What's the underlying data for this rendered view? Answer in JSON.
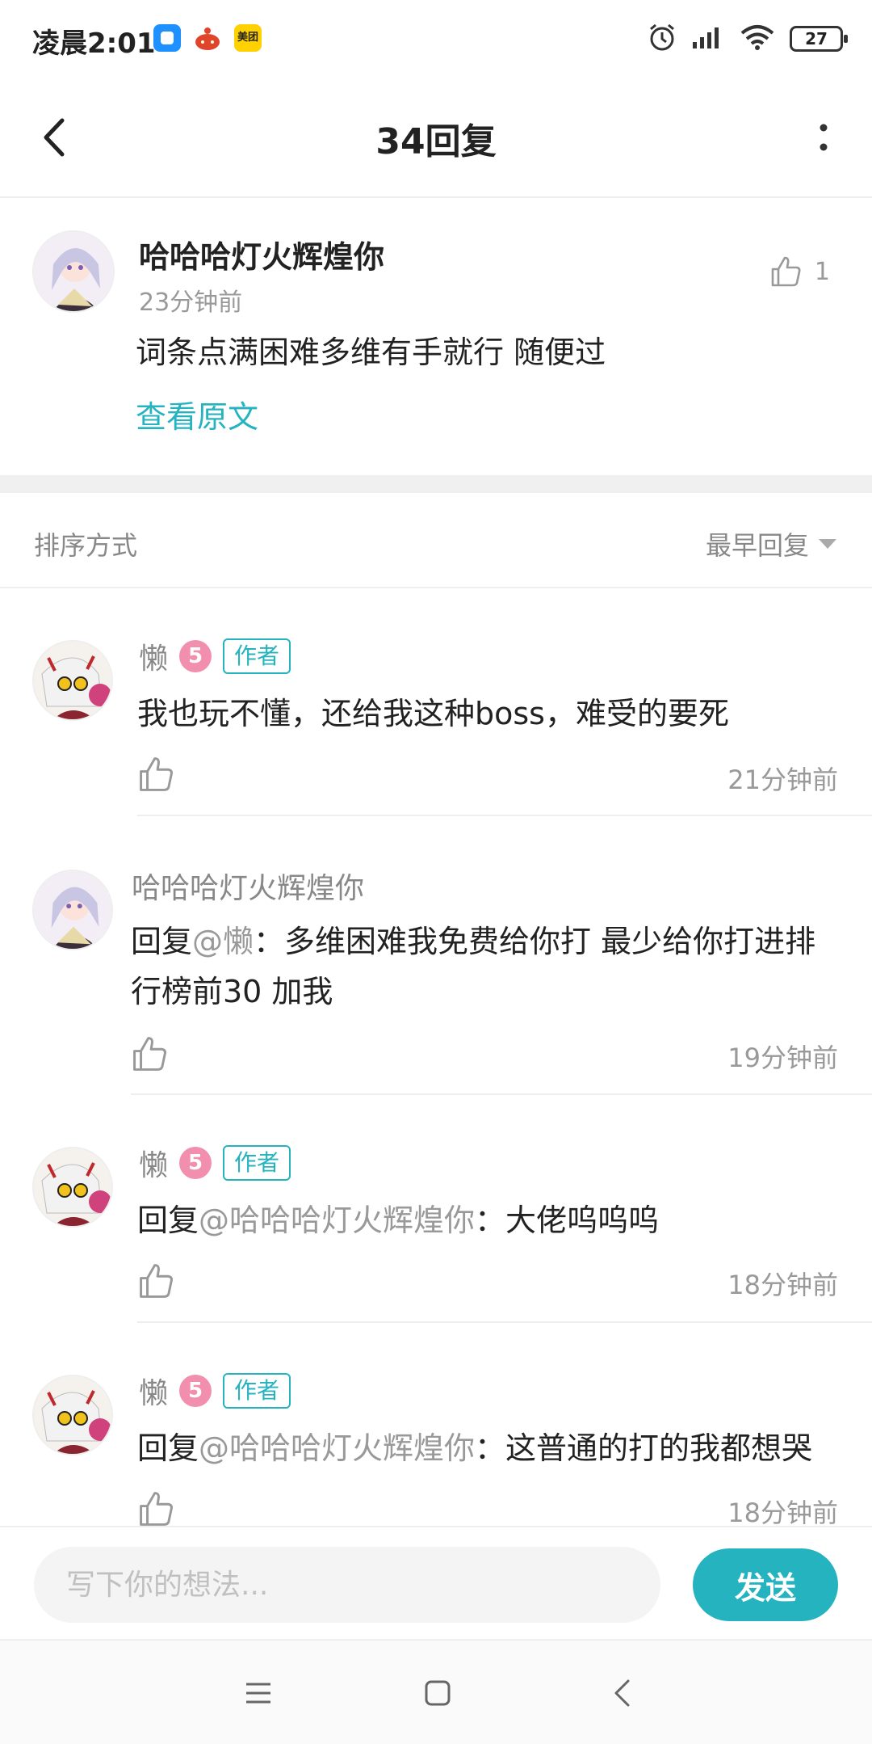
{
  "status_bar": {
    "time": "凌晨2:01",
    "app3_label": "美团",
    "battery": "27"
  },
  "header": {
    "title": "34回复"
  },
  "original_comment": {
    "name": "哈哈哈灯火辉煌你",
    "time": "23分钟前",
    "likes": "1",
    "text": "词条点满困难多维有手就行 随便过",
    "view_original": "查看原文"
  },
  "sort": {
    "label": "排序方式",
    "selected": "最早回复"
  },
  "replies": [
    {
      "name": "懒",
      "level": "5",
      "tag": "作者",
      "prefix": "",
      "mention": "",
      "text": "我也玩不懂，还给我这种boss，难受的要死",
      "time": "21分钟前"
    },
    {
      "name": "哈哈哈灯火辉煌你",
      "prefix": "回复",
      "mention": "@懒",
      "text": "：多维困难我免费给你打 最少给你打进排行榜前30 加我",
      "time": "19分钟前"
    },
    {
      "name": "懒",
      "level": "5",
      "tag": "作者",
      "prefix": "回复",
      "mention": "@哈哈哈灯火辉煌你",
      "text": "：大佬呜呜呜",
      "time": "18分钟前"
    },
    {
      "name": "懒",
      "level": "5",
      "tag": "作者",
      "prefix": "回复",
      "mention": "@哈哈哈灯火辉煌你",
      "text": "：这普通的打的我都想哭",
      "time": "18分钟前"
    }
  ],
  "input": {
    "placeholder": "写下你的想法...",
    "send_label": "发送"
  },
  "colors": {
    "accent": "#26b3c0",
    "level_badge": "#f28fae",
    "muted_text": "#999999"
  },
  "icons": {
    "back": "chevron-left-icon",
    "more": "more-vertical-icon",
    "like": "thumb-up-icon",
    "sort_caret": "caret-down-icon",
    "nav": [
      "menu-icon",
      "home-square-icon",
      "back-triangle-icon"
    ]
  }
}
